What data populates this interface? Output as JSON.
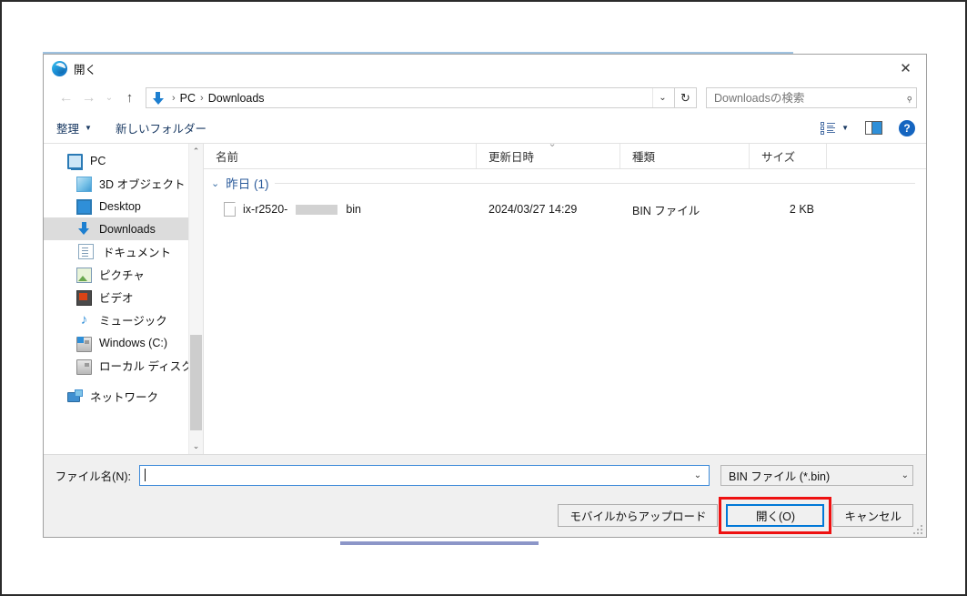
{
  "dialog": {
    "title": "開く",
    "close_label": "✕",
    "titlebar_icon": "edge-browser-icon"
  },
  "nav": {
    "back": "←",
    "forward": "→",
    "recent": "⌄",
    "up": "↑",
    "breadcrumb": [
      "PC",
      "Downloads"
    ],
    "breadcrumb_separator": "›",
    "address_chevron": "⌄",
    "refresh": "↻",
    "search_placeholder": "Downloadsの検索",
    "search_value": "",
    "search_icon": "search-icon"
  },
  "commandbar": {
    "organize_label": "整理",
    "organize_caret": "▼",
    "new_folder_label": "新しいフォルダー",
    "view_icon": "view-options-icon",
    "view_caret": "▼",
    "preview_pane_icon": "preview-pane-icon",
    "help_icon": "?"
  },
  "sidebar": {
    "items": [
      {
        "label": "PC",
        "icon": "pc-icon",
        "indent": false,
        "selected": false
      },
      {
        "label": "3D オブジェクト",
        "icon": "3d-objects-icon",
        "indent": true,
        "selected": false
      },
      {
        "label": "Desktop",
        "icon": "desktop-icon",
        "indent": true,
        "selected": false
      },
      {
        "label": "Downloads",
        "icon": "downloads-icon",
        "indent": true,
        "selected": true
      },
      {
        "label": "ドキュメント",
        "icon": "documents-icon",
        "indent": true,
        "selected": false
      },
      {
        "label": "ピクチャ",
        "icon": "pictures-icon",
        "indent": true,
        "selected": false
      },
      {
        "label": "ビデオ",
        "icon": "videos-icon",
        "indent": true,
        "selected": false
      },
      {
        "label": "ミュージック",
        "icon": "music-icon",
        "indent": true,
        "selected": false
      },
      {
        "label": "Windows (C:)",
        "icon": "drive-icon",
        "indent": true,
        "selected": false
      },
      {
        "label": "ローカル ディスク (D",
        "icon": "drive-icon",
        "indent": true,
        "selected": false
      },
      {
        "label": "ネットワーク",
        "icon": "network-icon",
        "indent": false,
        "selected": false
      }
    ],
    "scroll_up": "⌃",
    "scroll_down": "⌄"
  },
  "filelist": {
    "columns": [
      {
        "label": "名前",
        "sorted": false
      },
      {
        "label": "更新日時",
        "sorted": true
      },
      {
        "label": "種類",
        "sorted": false
      },
      {
        "label": "サイズ",
        "sorted": false
      }
    ],
    "group": {
      "caret": "⌄",
      "label": "昨日 (1)"
    },
    "rows": [
      {
        "name_prefix": "ix-r2520-",
        "name_suffix": "bin",
        "redacted": true,
        "date": "2024/03/27 14:29",
        "type": "BIN ファイル",
        "size": "2 KB"
      }
    ]
  },
  "footer": {
    "filename_label": "ファイル名(N):",
    "filename_value": "",
    "filename_chevron": "⌄",
    "filter_value": "BIN ファイル (*.bin)",
    "filter_chevron": "⌄",
    "upload_button": "モバイルからアップロード",
    "open_button": "開く(O)",
    "cancel_button": "キャンセル"
  },
  "annotation": {
    "color": "#ee1111",
    "target": "open-button"
  }
}
